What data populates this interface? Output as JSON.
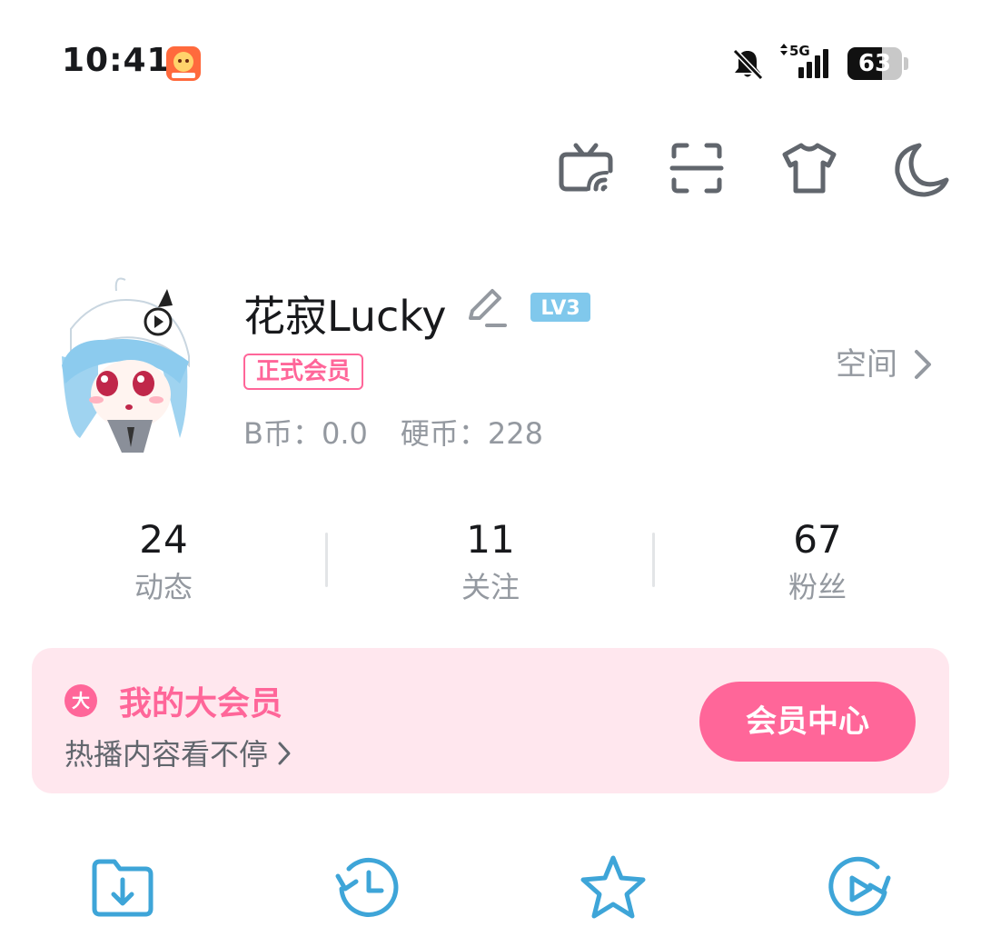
{
  "status_bar": {
    "time": "10:41",
    "network": "5G",
    "battery_level": 63,
    "battery_text": "63"
  },
  "toolbar": {
    "icons": [
      "tv-cast-icon",
      "scan-icon",
      "tshirt-icon",
      "moon-icon"
    ]
  },
  "profile": {
    "username": "花寂Lucky",
    "level": "LV3",
    "vip_tag": "正式会员",
    "b_coins_label": "B币：",
    "b_coins_value": "0.0",
    "coins_label": "硬币：",
    "coins_value": "228",
    "space_label": "空间"
  },
  "stats": [
    {
      "value": "24",
      "label": "动态"
    },
    {
      "value": "11",
      "label": "关注"
    },
    {
      "value": "67",
      "label": "粉丝"
    }
  ],
  "vip_card": {
    "badge": "大",
    "title": "我的大会员",
    "subtitle": "热播内容看不停",
    "button": "会员中心"
  },
  "quick_icons": [
    "download-folder-icon",
    "history-icon",
    "star-icon",
    "watch-later-icon"
  ],
  "colors": {
    "accent": "#ff6699",
    "icon_blue": "#3ea5d8",
    "level_blue": "#80c8ec",
    "vip_bg": "#ffe7ee",
    "muted": "#9499a0"
  }
}
